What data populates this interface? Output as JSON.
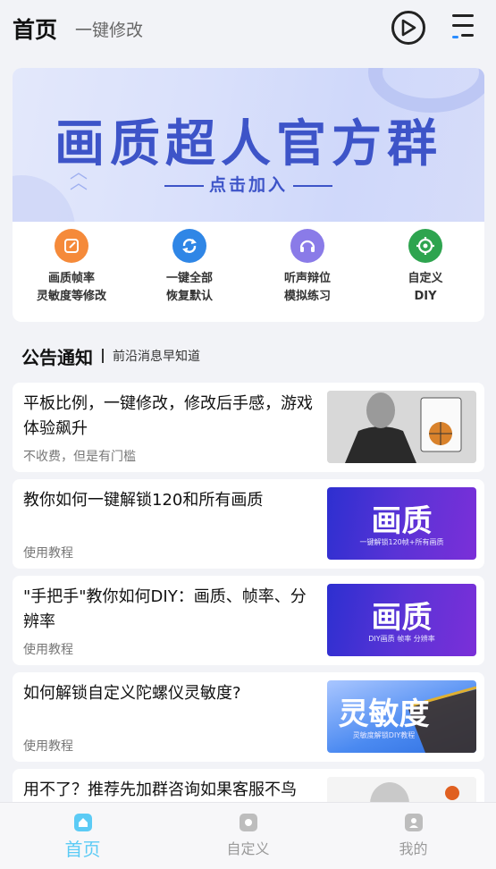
{
  "header": {
    "title": "首页",
    "subtitle": "一键修改"
  },
  "banner": {
    "headline": "画质超人官方群",
    "join": "点击加入"
  },
  "quick": [
    {
      "line1": "画质帧率",
      "line2": "灵敏度等修改",
      "color": "#f58a3a",
      "icon": "edit-icon"
    },
    {
      "line1": "一键全部",
      "line2": "恢复默认",
      "color": "#2f86e6",
      "icon": "refresh-icon"
    },
    {
      "line1": "听声辩位",
      "line2": "模拟练习",
      "color": "#8a7be8",
      "icon": "headphones-icon"
    },
    {
      "line1": "自定义",
      "line2": "DIY",
      "color": "#2ea44f",
      "icon": "crosshair-icon"
    }
  ],
  "section": {
    "title": "公告通知",
    "subtitle": "前沿消息早知道"
  },
  "articles": [
    {
      "title": "平板比例，一键修改，修改后手感，游戏体验飙升",
      "sub": "不收费，但是有门槛"
    },
    {
      "title": "教你如何一键解锁120和所有画质",
      "sub": "使用教程",
      "thumb_big": "画质",
      "thumb_small": "一键解锁120帧+所有画质"
    },
    {
      "title": "\"手把手\"教你如何DIY：画质、帧率、分辨率",
      "sub": "使用教程",
      "thumb_big": "画质",
      "thumb_small": "DIY画质 帧率 分辨率"
    },
    {
      "title": "如何解锁自定义陀螺仪灵敏度?",
      "sub": "使用教程",
      "thumb_big": "灵敏度",
      "thumb_small": "灵敏度解锁DIY教程"
    },
    {
      "title": "用不了？推荐先加群咨询如果客服不鸟"
    }
  ],
  "tabs": [
    {
      "label": "首页"
    },
    {
      "label": "自定义"
    },
    {
      "label": "我的"
    }
  ],
  "colors": {
    "accent": "#5ccbf5",
    "banner_text": "#3d54c8"
  }
}
